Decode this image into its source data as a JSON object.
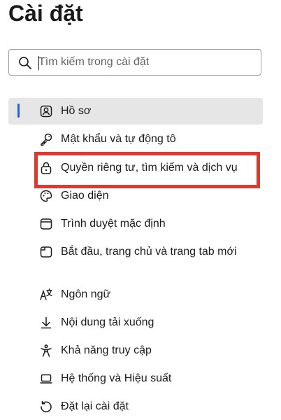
{
  "page": {
    "title": "Cài đặt"
  },
  "search": {
    "placeholder": "Tìm kiếm trong cài đặt",
    "value": ""
  },
  "nav": {
    "selected_index": 0,
    "items": [
      {
        "label": "Hồ sơ",
        "icon": "profile-icon"
      },
      {
        "label": "Mật khẩu và tự động tô",
        "icon": "key-icon"
      },
      {
        "label": "Quyền riêng tư, tìm kiếm và dịch vụ",
        "icon": "lock-icon"
      },
      {
        "label": "Giao diện",
        "icon": "palette-icon"
      },
      {
        "label": "Trình duyệt mặc định",
        "icon": "browser-icon"
      },
      {
        "label": "Bắt đầu, trang chủ và trang tab mới",
        "icon": "start-page-icon"
      },
      {
        "label": "Ngôn ngữ",
        "icon": "language-icon"
      },
      {
        "label": "Nội dung tải xuống",
        "icon": "download-icon"
      },
      {
        "label": "Khả năng truy cập",
        "icon": "accessibility-icon"
      },
      {
        "label": "Hệ thống và Hiệu suất",
        "icon": "laptop-icon"
      },
      {
        "label": "Đặt lại cài đặt",
        "icon": "reset-icon"
      }
    ]
  },
  "annotation": {
    "highlight_color": "#e0382f",
    "highlighted_item_index": 2
  },
  "colors": {
    "accent": "#2563d4",
    "selected_bg": "#e6e6e6"
  }
}
